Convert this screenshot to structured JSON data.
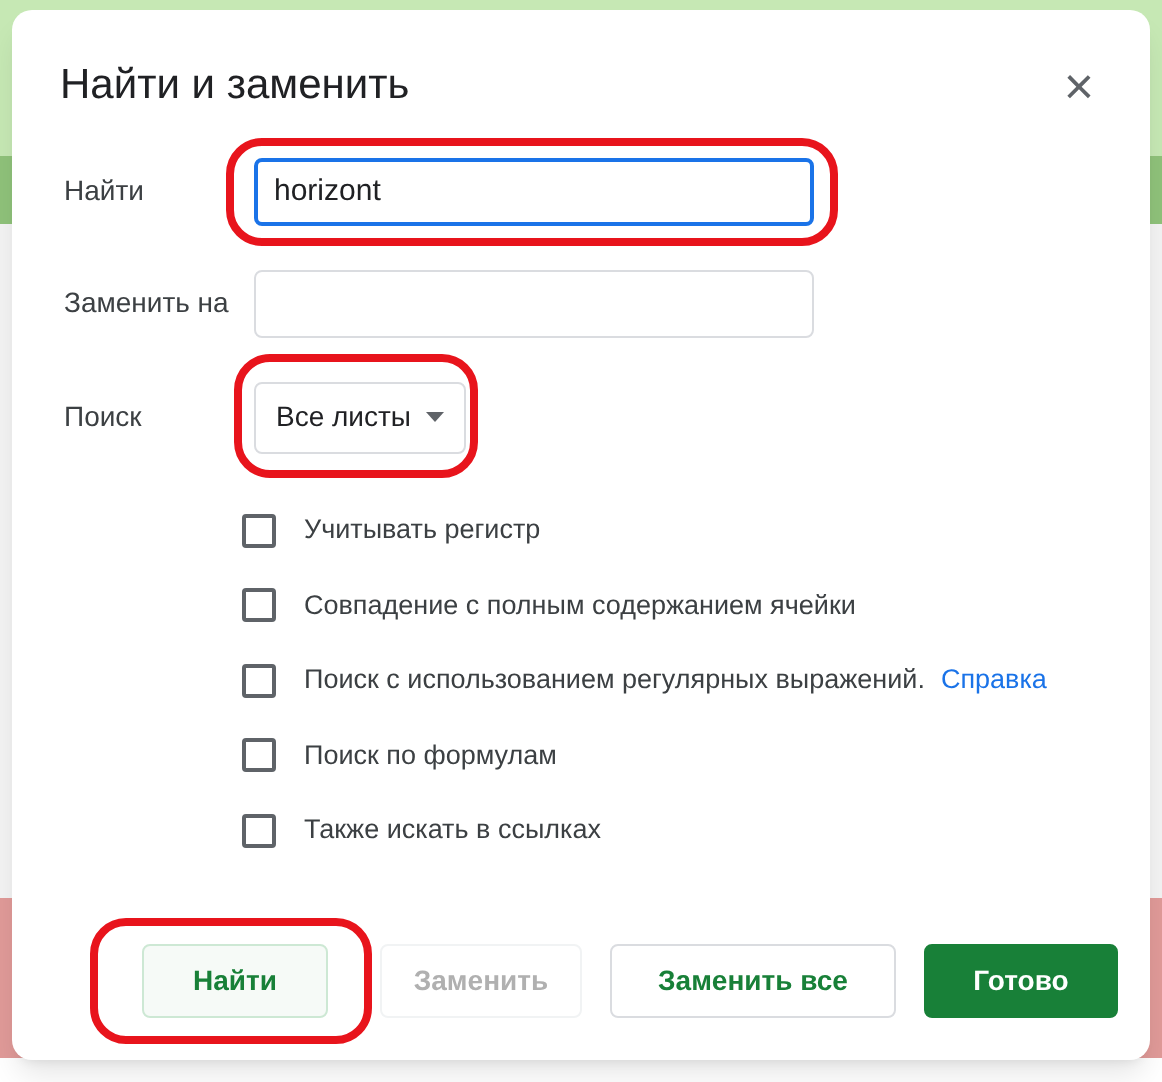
{
  "dialog": {
    "title": "Найти и заменить",
    "close": "×"
  },
  "fields": [
    {
      "label": "Найти",
      "value": "horizont",
      "focused": true,
      "circled": true
    },
    {
      "label": "Заменить на",
      "focused": false
    }
  ],
  "search": {
    "label": "Поиск",
    "value": "Все листы",
    "circled": true
  },
  "options": [
    {
      "label": "Учитывать регистр",
      "checked": false
    },
    {
      "label": "Совпадение с полным содержанием ячейки",
      "checked": false
    },
    {
      "label": "Поиск с использованием регулярных выражений.",
      "checked": false,
      "link": "Справка"
    },
    {
      "label": "Поиск по формулам",
      "checked": false
    },
    {
      "label": "Также искать в ссылках",
      "checked": false
    }
  ],
  "buttons": [
    {
      "label": "Найти",
      "kind": "secondary",
      "disabled": false,
      "circled": true
    },
    {
      "label": "Заменить",
      "kind": "outline",
      "disabled": true
    },
    {
      "label": "Заменить все",
      "kind": "outline",
      "disabled": false
    },
    {
      "label": "Готово",
      "kind": "primary",
      "disabled": false
    }
  ]
}
